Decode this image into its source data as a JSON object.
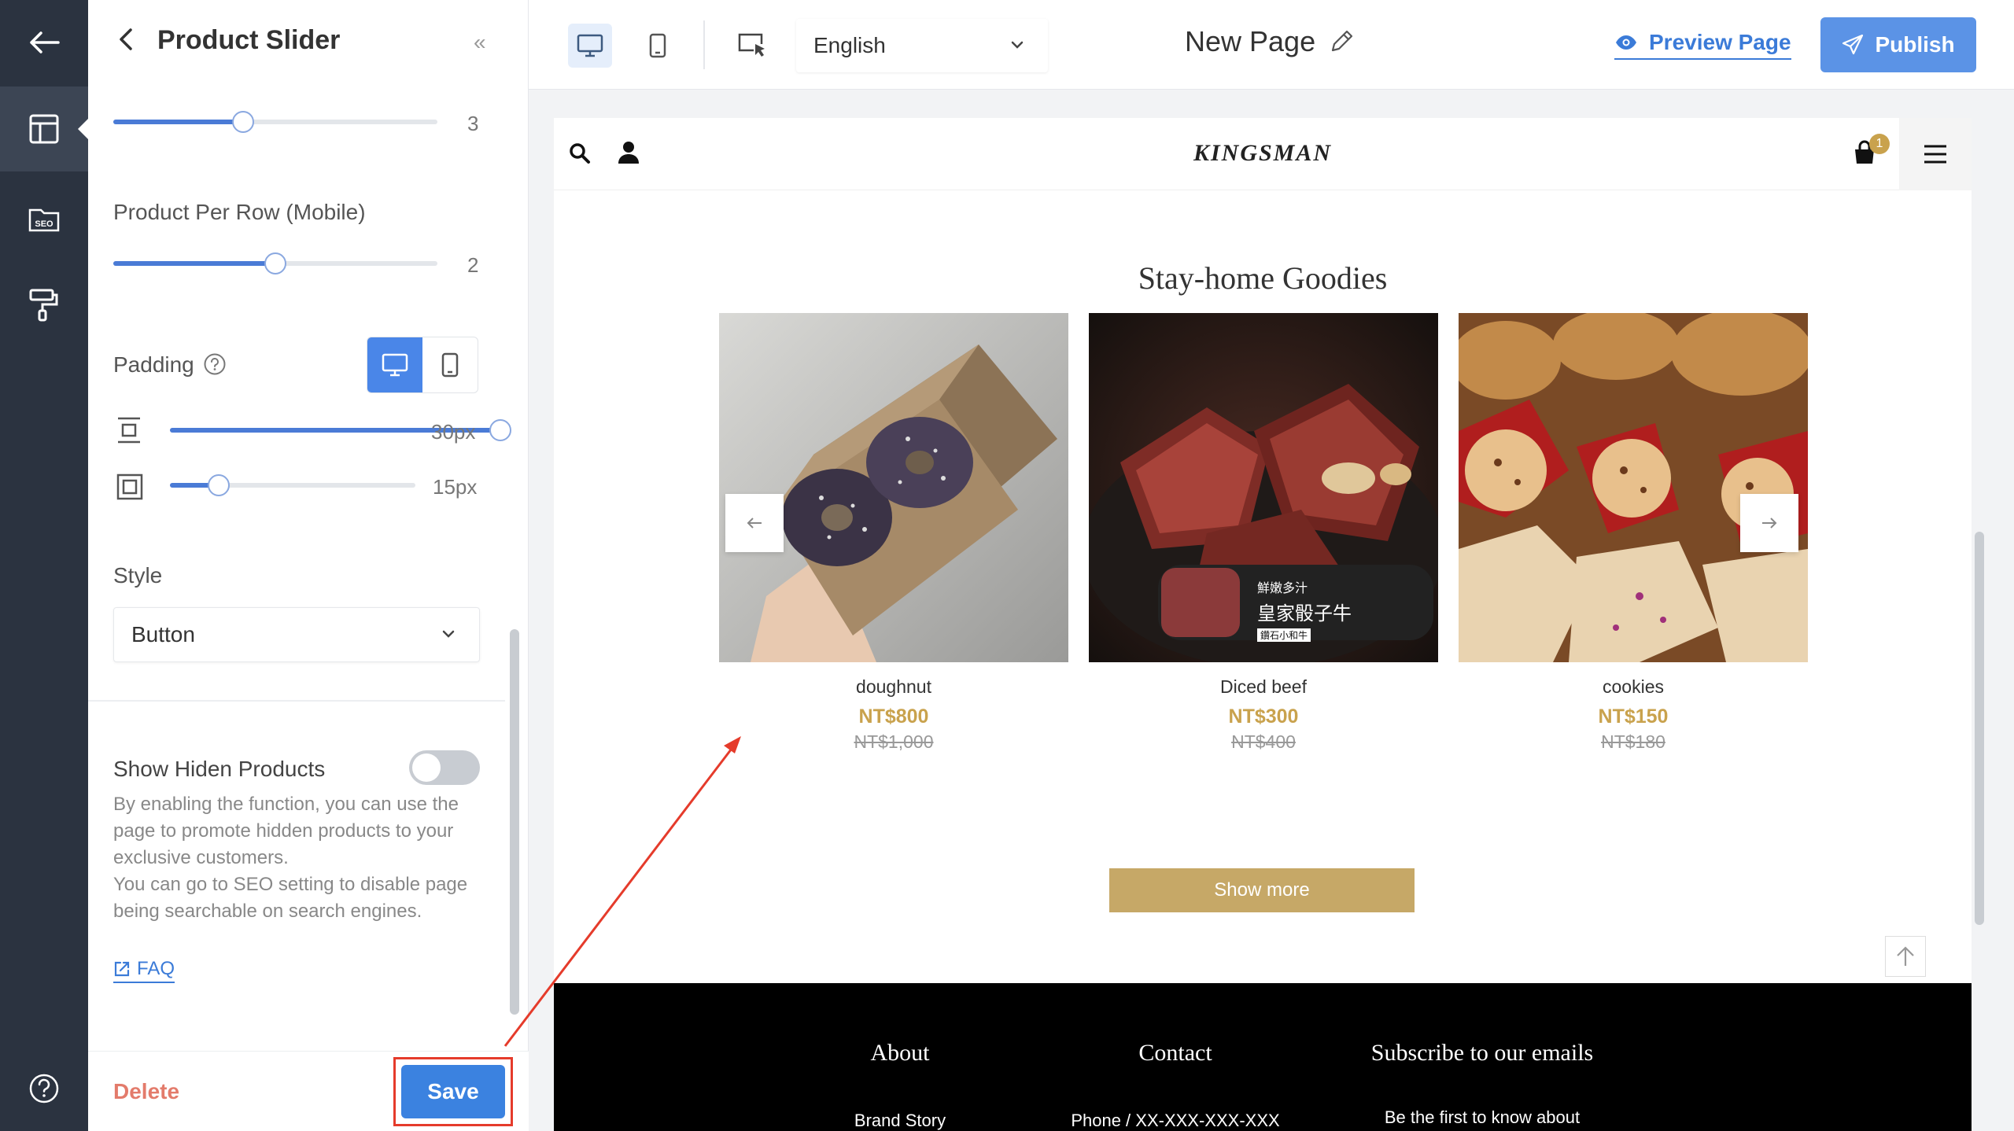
{
  "panel": {
    "title": "Product Slider",
    "slider_desktop_value": "3",
    "slider_desktop_fraction": 0.4,
    "mobile_label": "Product Per Row (Mobile)",
    "slider_mobile_value": "2",
    "slider_mobile_fraction": 0.5,
    "padding_label": "Padding",
    "padding_vertical_value": "30px",
    "padding_vertical_fraction": 1.0,
    "padding_horizontal_value": "15px",
    "padding_horizontal_fraction": 0.2,
    "style_label": "Style",
    "style_selected": "Button",
    "hidden_label": "Show Hiden Products",
    "hidden_enabled": false,
    "hidden_help": "By enabling the function, you can use the page to promote hidden products to your exclusive customers.\nYou can go to SEO setting to disable page being searchable on search engines.",
    "faq_label": "FAQ",
    "delete_label": "Delete",
    "save_label": "Save"
  },
  "topbar": {
    "language": "English",
    "page_title": "New Page",
    "preview_label": "Preview Page",
    "publish_label": "Publish"
  },
  "site": {
    "brand": "KINGSMAN",
    "cart_count": "1",
    "section_title": "Stay-home Goodies",
    "products": [
      {
        "name": "doughnut",
        "price": "NT$800",
        "original": "NT$1,000"
      },
      {
        "name": "Diced beef",
        "price": "NT$300",
        "original": "NT$400"
      },
      {
        "name": "cookies",
        "price": "NT$150",
        "original": "NT$180"
      }
    ],
    "beef_badge_line1": "鮮嫩多汁",
    "beef_badge_line2": "皇家骰子牛",
    "beef_badge_line3": "鑽石小和牛",
    "show_more": "Show more",
    "footer": {
      "about": "About",
      "contact": "Contact",
      "subscribe": "Subscribe to our emails",
      "brand_story": "Brand Story",
      "phone": "Phone / XX-XXX-XXX-XXX",
      "subscribe_text": "Be the first to know about"
    }
  },
  "colors": {
    "accent": "#4a86e8",
    "gold": "#c9a24d",
    "annotation": "#e53b2b"
  }
}
